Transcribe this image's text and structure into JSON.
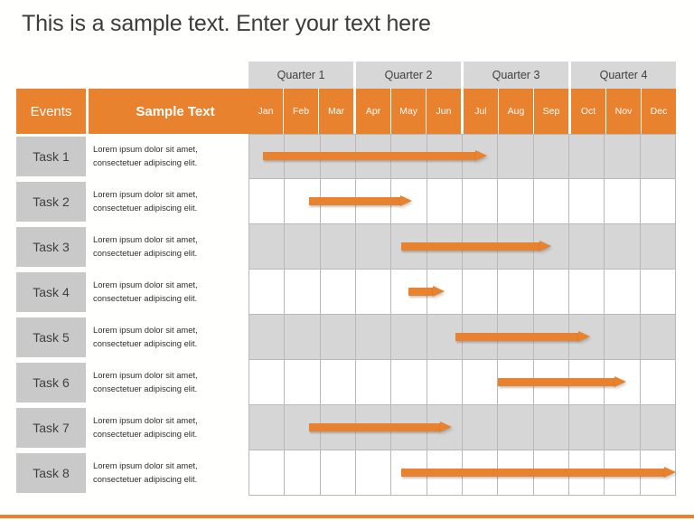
{
  "slide": {
    "title": "This is a sample text. Enter your text here",
    "accent_color": "#e8822e",
    "header_gray": "#d7d7d7",
    "label_gray": "#c9c9c9",
    "row_shade": "#d6d6d6"
  },
  "table": {
    "col_events_label": "Events",
    "col_sample_label": "Sample Text",
    "quarters": [
      {
        "label": "Quarter 1"
      },
      {
        "label": "Quarter 2"
      },
      {
        "label": "Quarter 3"
      },
      {
        "label": "Quarter 4"
      }
    ],
    "months": [
      "Jan",
      "Feb",
      "Mar",
      "Apr",
      "May",
      "Jun",
      "Jul",
      "Aug",
      "Sep",
      "Oct",
      "Nov",
      "Dec"
    ]
  },
  "chart_data": {
    "type": "bar",
    "title": "This is a sample text. Enter your text here",
    "xlabel": "",
    "ylabel": "Events",
    "categories": [
      "Task 1",
      "Task 2",
      "Task 3",
      "Task 4",
      "Task 5",
      "Task 6",
      "Task 7",
      "Task 8"
    ],
    "x_tick_labels": [
      "Jan",
      "Feb",
      "Mar",
      "Apr",
      "May",
      "Jun",
      "Jul",
      "Aug",
      "Sep",
      "Oct",
      "Nov",
      "Dec"
    ],
    "x_group_labels": [
      "Quarter 1",
      "Quarter 2",
      "Quarter 3",
      "Quarter 4"
    ],
    "xlim": [
      0,
      12
    ],
    "grid": true,
    "legend": false,
    "bar_color": "#e8822e",
    "tasks": [
      {
        "name": "Task 1",
        "description": "Lorem ipsum dolor sit amet, consectetuer adipiscing elit.",
        "start_month": 0.4,
        "end_month": 6.7,
        "start_label": "Jan",
        "end_label": "Jul"
      },
      {
        "name": "Task 2",
        "description": "Lorem ipsum dolor sit amet, consectetuer adipiscing elit.",
        "start_month": 1.7,
        "end_month": 4.6,
        "start_label": "Feb",
        "end_label": "May"
      },
      {
        "name": "Task 3",
        "description": "Lorem ipsum dolor sit amet, consectetuer adipiscing elit.",
        "start_month": 4.3,
        "end_month": 8.5,
        "start_label": "May",
        "end_label": "Sep"
      },
      {
        "name": "Task 4",
        "description": "Lorem ipsum dolor sit amet, consectetuer adipiscing elit.",
        "start_month": 4.5,
        "end_month": 5.5,
        "start_label": "May",
        "end_label": "Jun"
      },
      {
        "name": "Task 5",
        "description": "Lorem ipsum dolor sit amet, consectetuer adipiscing elit.",
        "start_month": 5.8,
        "end_month": 9.6,
        "start_label": "Jun",
        "end_label": "Oct"
      },
      {
        "name": "Task 6",
        "description": "Lorem ipsum dolor sit amet, consectetuer adipiscing elit.",
        "start_month": 7.0,
        "end_month": 10.6,
        "start_label": "Aug",
        "end_label": "Nov"
      },
      {
        "name": "Task 7",
        "description": "Lorem ipsum dolor sit amet, consectetuer adipiscing elit.",
        "start_month": 1.7,
        "end_month": 5.7,
        "start_label": "Feb",
        "end_label": "Jun"
      },
      {
        "name": "Task 8",
        "description": "Lorem ipsum dolor sit amet, consectetuer adipiscing elit.",
        "start_month": 4.3,
        "end_month": 12.0,
        "start_label": "May",
        "end_label": "Dec"
      }
    ]
  }
}
